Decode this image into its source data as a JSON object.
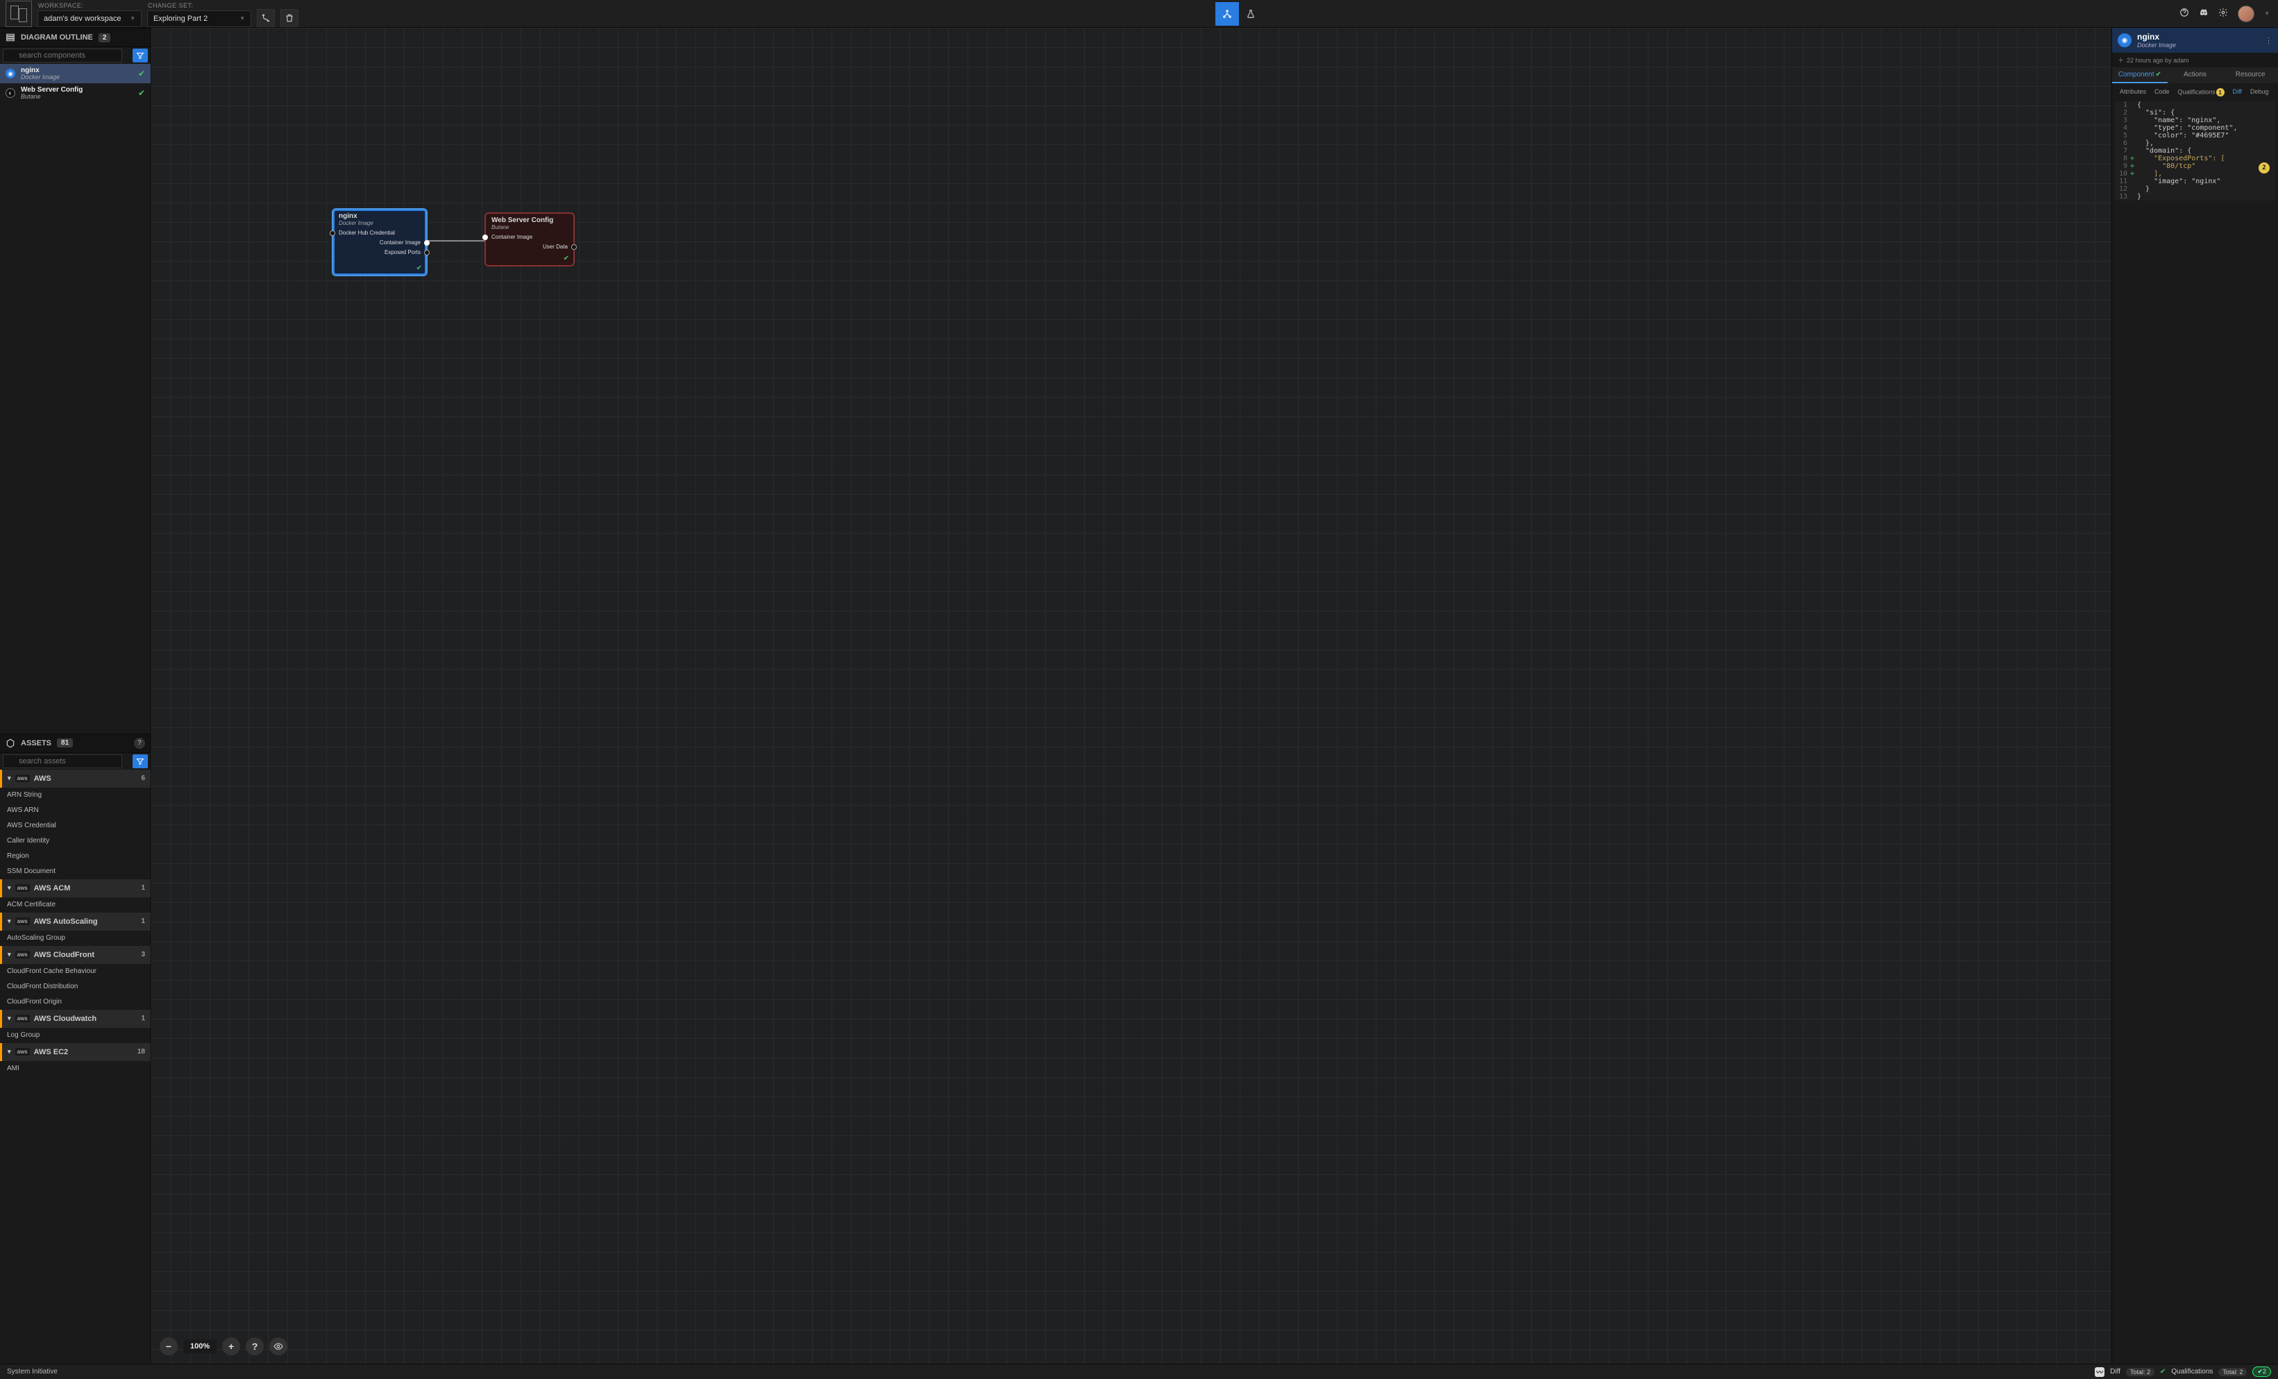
{
  "topbar": {
    "workspace_label": "WORKSPACE:",
    "workspace_value": "adam's dev workspace",
    "changeset_label": "CHANGE SET:",
    "changeset_value": "Exploring Part 2"
  },
  "outline": {
    "title": "DIAGRAM OUTLINE",
    "count": "2",
    "search_placeholder": "search components",
    "items": [
      {
        "title": "nginx",
        "sub": "Docker Image",
        "icon": "docker",
        "selected": true
      },
      {
        "title": "Web Server Config",
        "sub": "Butane",
        "icon": "butane",
        "selected": false
      }
    ]
  },
  "assets": {
    "title": "ASSETS",
    "count": "81",
    "search_placeholder": "search assets",
    "groups": [
      {
        "name": "AWS",
        "count": "6",
        "items": [
          "ARN String",
          "AWS ARN",
          "AWS Credential",
          "Caller Identity",
          "Region",
          "SSM Document"
        ]
      },
      {
        "name": "AWS ACM",
        "count": "1",
        "items": [
          "ACM Certificate"
        ]
      },
      {
        "name": "AWS AutoScaling",
        "count": "1",
        "items": [
          "AutoScaling Group"
        ]
      },
      {
        "name": "AWS CloudFront",
        "count": "3",
        "items": [
          "CloudFront Cache Behaviour",
          "CloudFront Distribution",
          "CloudFront Origin"
        ]
      },
      {
        "name": "AWS Cloudwatch",
        "count": "1",
        "items": [
          "Log Group"
        ]
      },
      {
        "name": "AWS EC2",
        "count": "18",
        "items": [
          "AMI"
        ]
      }
    ]
  },
  "canvas": {
    "zoom": "100%",
    "nginx": {
      "title": "nginx",
      "sub": "Docker Image",
      "in": "Docker Hub Credential",
      "out1": "Container Image",
      "out2": "Exposed Ports"
    },
    "butane": {
      "title": "Web Server Config",
      "sub": "Butane",
      "in": "Container Image",
      "out": "User Data"
    }
  },
  "detail": {
    "title": "nginx",
    "sub": "Docker Image",
    "meta": "22 hours ago by adam",
    "tabs1": {
      "component": "Component",
      "actions": "Actions",
      "resource": "Resource"
    },
    "tabs2": {
      "attributes": "Attributes",
      "code": "Code",
      "qual": "Qualifications",
      "qual_badge": "1",
      "diff": "Diff",
      "debug": "Debug"
    },
    "side_badge": "2",
    "code": [
      {
        "n": "1",
        "plus": "",
        "t": "{"
      },
      {
        "n": "2",
        "plus": "",
        "t": "  \"si\": {"
      },
      {
        "n": "3",
        "plus": "",
        "t": "    \"name\": \"nginx\","
      },
      {
        "n": "4",
        "plus": "",
        "t": "    \"type\": \"component\","
      },
      {
        "n": "5",
        "plus": "",
        "t": "    \"color\": \"#4695E7\""
      },
      {
        "n": "6",
        "plus": "",
        "t": "  },"
      },
      {
        "n": "7",
        "plus": "",
        "t": "  \"domain\": {"
      },
      {
        "n": "8",
        "plus": "+",
        "t": "    \"ExposedPorts\": ["
      },
      {
        "n": "9",
        "plus": "+",
        "t": "      \"80/tcp\""
      },
      {
        "n": "10",
        "plus": "+",
        "t": "    ],"
      },
      {
        "n": "11",
        "plus": "",
        "t": "    \"image\": \"nginx\""
      },
      {
        "n": "12",
        "plus": "",
        "t": "  }"
      },
      {
        "n": "13",
        "plus": "",
        "t": "}"
      }
    ]
  },
  "footer": {
    "sysname": "System Initiative",
    "diff": "Diff",
    "diff_total": "Total: 2",
    "qual": "Qualifications",
    "qual_total": "Total: 2",
    "qual_ok": "2"
  }
}
